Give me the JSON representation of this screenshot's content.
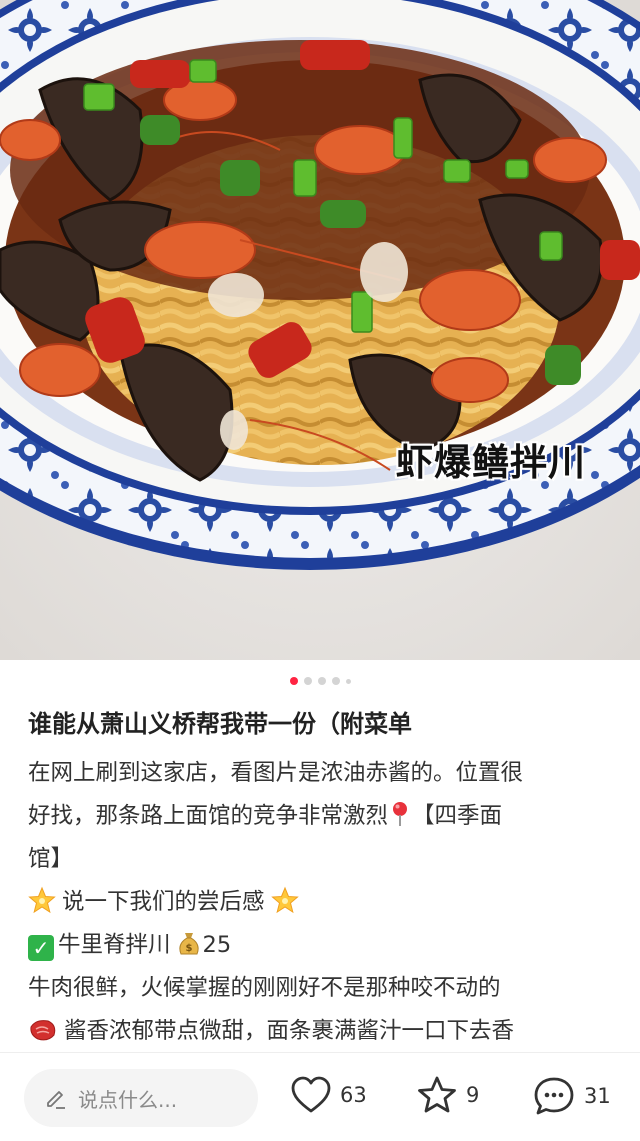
{
  "image": {
    "caption": "虾爆鳝拌川"
  },
  "carousel": {
    "count": 5,
    "active_index": 0
  },
  "post": {
    "title": "谁能从萧山义桥帮我带一份（附菜单",
    "line1": "在网上刷到这家店，看图片是浓油赤酱的。位置很",
    "line2a": "好找，那条路上面馆的竞争非常激烈",
    "line2b": "【四季面",
    "line3": "馆】",
    "line4": "说一下我们的尝后感",
    "line5a": "牛里脊拌川",
    "line5b": "25",
    "line6": "牛肉很鲜，火候掌握的刚刚好不是那种咬不动的",
    "line7": "酱香浓郁带点微甜，面条裹满酱汁一口下去香"
  },
  "bottom_bar": {
    "comment_placeholder": "说点什么...",
    "likes": "63",
    "collects": "9",
    "comments": "31"
  },
  "colors": {
    "accent": "#ff2442",
    "bowl_blue": "#1f3f9a"
  },
  "icons": [
    "pin-icon",
    "sparkle-star-icon",
    "check-icon",
    "money-bag-icon",
    "steak-icon",
    "pencil-icon",
    "heart-icon",
    "star-icon",
    "comment-icon"
  ]
}
